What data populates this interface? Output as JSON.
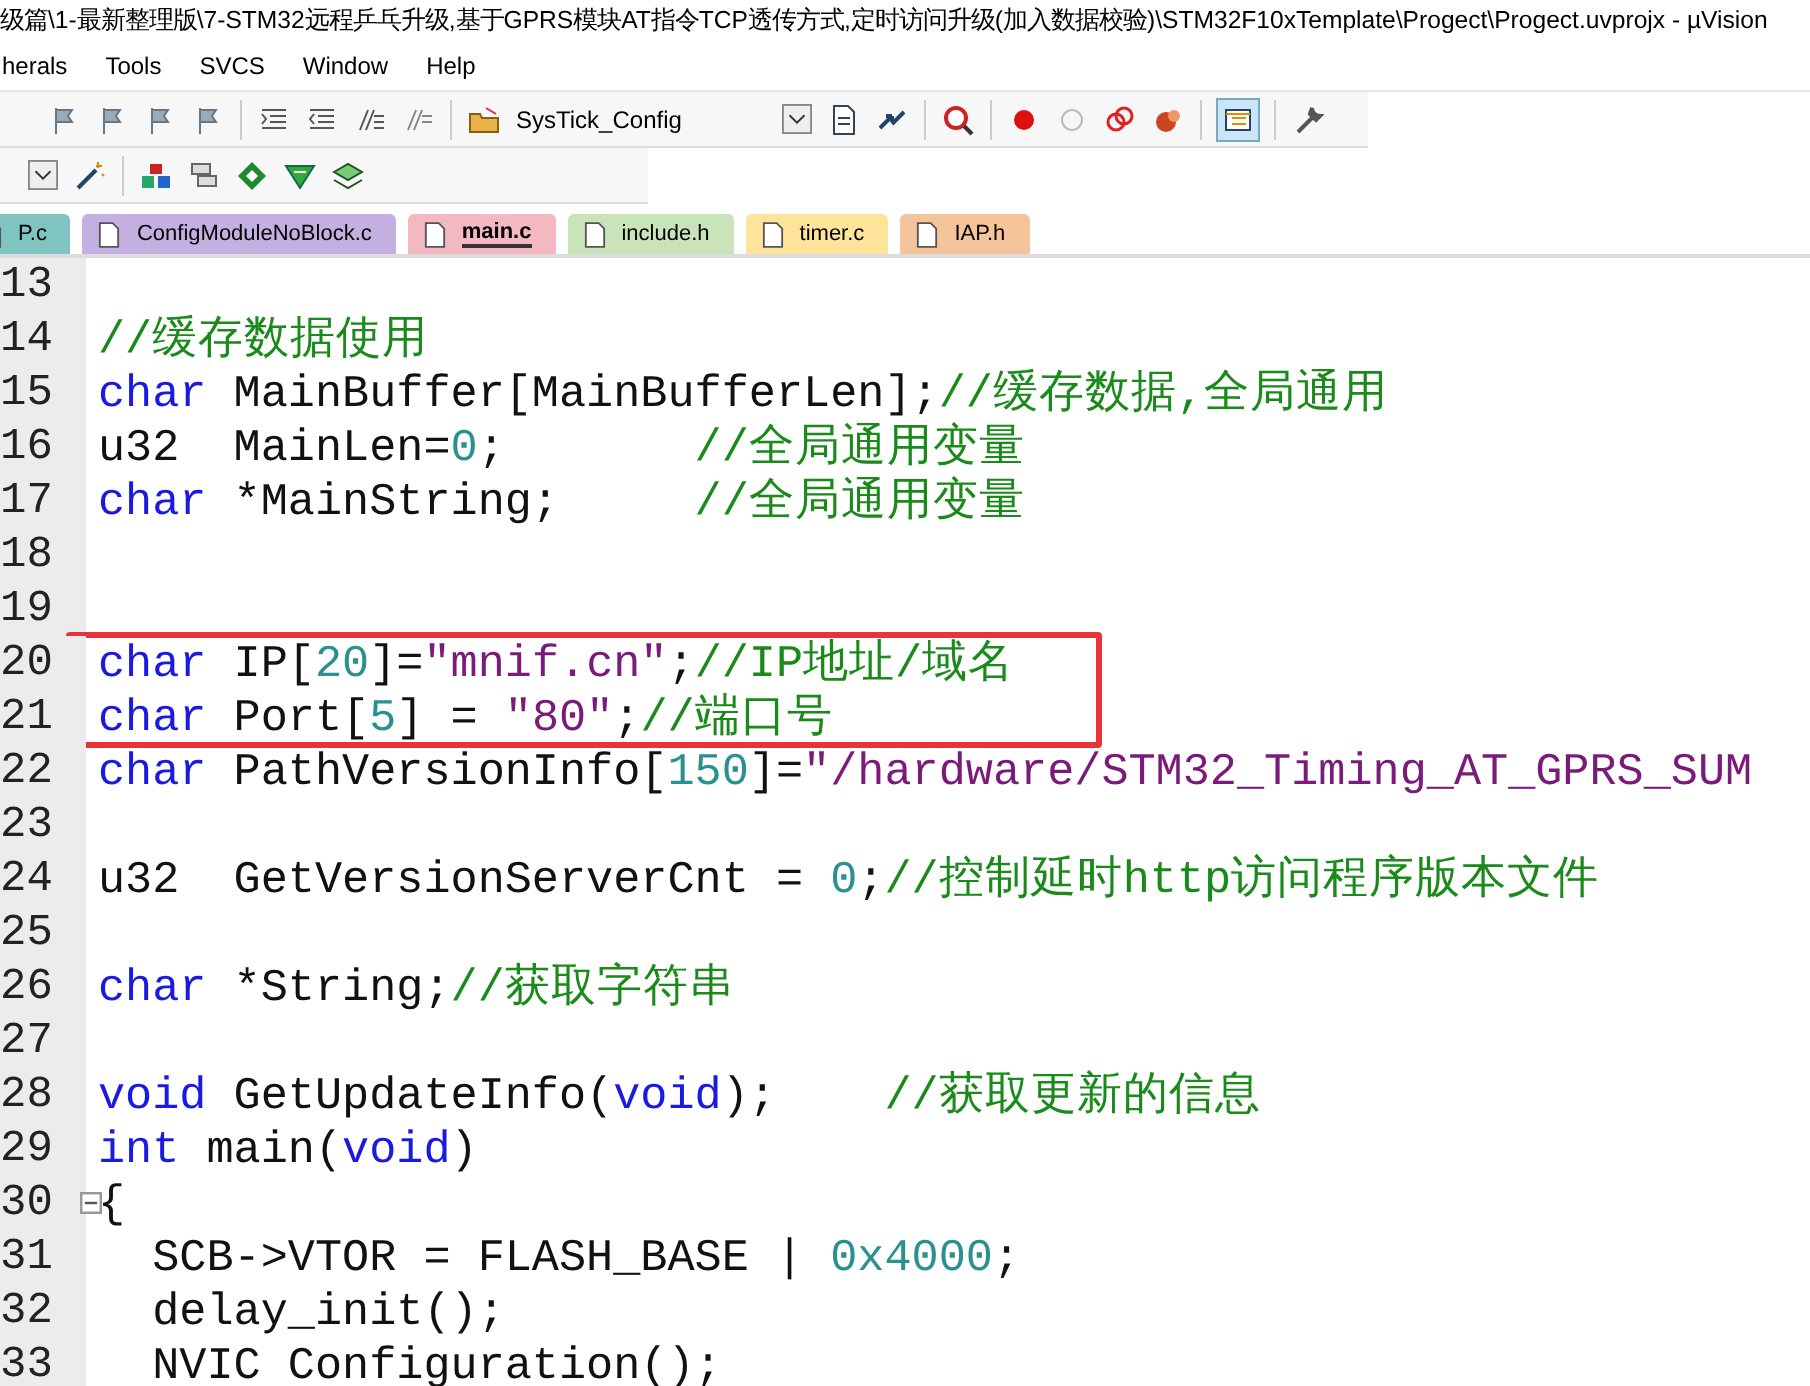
{
  "window": {
    "title": "级篇\\1-最新整理版\\7-STM32远程乒乓升级,基于GPRS模块AT指令TCP透传方式,定时访问升级(加入数据校验)\\STM32F10xTemplate\\Progect\\Progect.uvprojx - µVision"
  },
  "menu": [
    "herals",
    "Tools",
    "SVCS",
    "Window",
    "Help"
  ],
  "toolbar": {
    "target_combo": {
      "value": "SysTick_Config"
    }
  },
  "tabs": [
    {
      "label": "P.c",
      "color": "#7fc4c0",
      "selected": false
    },
    {
      "label": "ConfigModuleNoBlock.c",
      "color": "#c4b0e0",
      "selected": false
    },
    {
      "label": "main.c",
      "color": "#f4b8c0",
      "selected": true
    },
    {
      "label": "include.h",
      "color": "#c8e4b8",
      "selected": false
    },
    {
      "label": "timer.c",
      "color": "#fde49a",
      "selected": false
    },
    {
      "label": "IAP.h",
      "color": "#f6c49a",
      "selected": false
    }
  ],
  "editor": {
    "lines": [
      {
        "number": "13"
      },
      {
        "number": "14",
        "tokens": [
          {
            "kind": "cmt",
            "text": "//缓存数据使用"
          }
        ]
      },
      {
        "number": "15",
        "tokens": [
          {
            "kind": "kw",
            "text": "char"
          },
          {
            "kind": "id",
            "text": " MainBuffer[MainBufferLen];"
          },
          {
            "kind": "cmt",
            "text": "//缓存数据,全局通用"
          }
        ]
      },
      {
        "number": "16",
        "tokens": [
          {
            "kind": "id",
            "text": "u32  MainLen="
          },
          {
            "kind": "num",
            "text": "0"
          },
          {
            "kind": "id",
            "text": ";       "
          },
          {
            "kind": "cmt",
            "text": "//全局通用变量"
          }
        ]
      },
      {
        "number": "17",
        "tokens": [
          {
            "kind": "kw",
            "text": "char"
          },
          {
            "kind": "id",
            "text": " *MainString;     "
          },
          {
            "kind": "cmt",
            "text": "//全局通用变量"
          }
        ]
      },
      {
        "number": "18"
      },
      {
        "number": "19"
      },
      {
        "number": "20",
        "boxed": true,
        "tokens": [
          {
            "kind": "kw",
            "text": "char"
          },
          {
            "kind": "id",
            "text": " IP["
          },
          {
            "kind": "num",
            "text": "20"
          },
          {
            "kind": "id",
            "text": "]="
          },
          {
            "kind": "str",
            "text": "\"mnif.cn\""
          },
          {
            "kind": "id",
            "text": ";"
          },
          {
            "kind": "cmt",
            "text": "//IP地址/域名"
          }
        ]
      },
      {
        "number": "21",
        "boxed": true,
        "tokens": [
          {
            "kind": "kw",
            "text": "char"
          },
          {
            "kind": "id",
            "text": " Port["
          },
          {
            "kind": "num",
            "text": "5"
          },
          {
            "kind": "id",
            "text": "] = "
          },
          {
            "kind": "str",
            "text": "\"80\""
          },
          {
            "kind": "id",
            "text": ";"
          },
          {
            "kind": "cmt",
            "text": "//端口号"
          }
        ]
      },
      {
        "number": "22",
        "tokens": [
          {
            "kind": "kw",
            "text": "char"
          },
          {
            "kind": "id",
            "text": " PathVersionInfo["
          },
          {
            "kind": "num",
            "text": "150"
          },
          {
            "kind": "id",
            "text": "]="
          },
          {
            "kind": "str",
            "text": "\"/hardware/STM32_Timing_AT_GPRS_SUM"
          }
        ]
      },
      {
        "number": "23"
      },
      {
        "number": "24",
        "tokens": [
          {
            "kind": "id",
            "text": "u32  GetVersionServerCnt = "
          },
          {
            "kind": "num",
            "text": "0"
          },
          {
            "kind": "id",
            "text": ";"
          },
          {
            "kind": "cmt",
            "text": "//控制延时http访问程序版本文件"
          }
        ]
      },
      {
        "number": "25"
      },
      {
        "number": "26",
        "tokens": [
          {
            "kind": "kw",
            "text": "char"
          },
          {
            "kind": "id",
            "text": " *String;"
          },
          {
            "kind": "cmt",
            "text": "//获取字符串"
          }
        ]
      },
      {
        "number": "27"
      },
      {
        "number": "28",
        "tokens": [
          {
            "kind": "kw",
            "text": "void"
          },
          {
            "kind": "id",
            "text": " GetUpdateInfo("
          },
          {
            "kind": "kw",
            "text": "void"
          },
          {
            "kind": "id",
            "text": ");    "
          },
          {
            "kind": "cmt",
            "text": "//获取更新的信息"
          }
        ]
      },
      {
        "number": "29",
        "tokens": [
          {
            "kind": "kw",
            "text": "int"
          },
          {
            "kind": "id",
            "text": " main("
          },
          {
            "kind": "kw",
            "text": "void"
          },
          {
            "kind": "id",
            "text": ")"
          }
        ]
      },
      {
        "number": "30",
        "fold": true,
        "tokens": [
          {
            "kind": "id",
            "text": "{"
          }
        ]
      },
      {
        "number": "31",
        "tokens": [
          {
            "kind": "id",
            "text": "  SCB->VTOR = FLASH_BASE | "
          },
          {
            "kind": "num",
            "text": "0x4000"
          },
          {
            "kind": "id",
            "text": ";"
          }
        ]
      },
      {
        "number": "32",
        "tokens": [
          {
            "kind": "id",
            "text": "  delay_init();"
          }
        ]
      },
      {
        "number": "33",
        "tokens": [
          {
            "kind": "id",
            "text": "  NVIC Configuration();"
          }
        ]
      }
    ]
  }
}
